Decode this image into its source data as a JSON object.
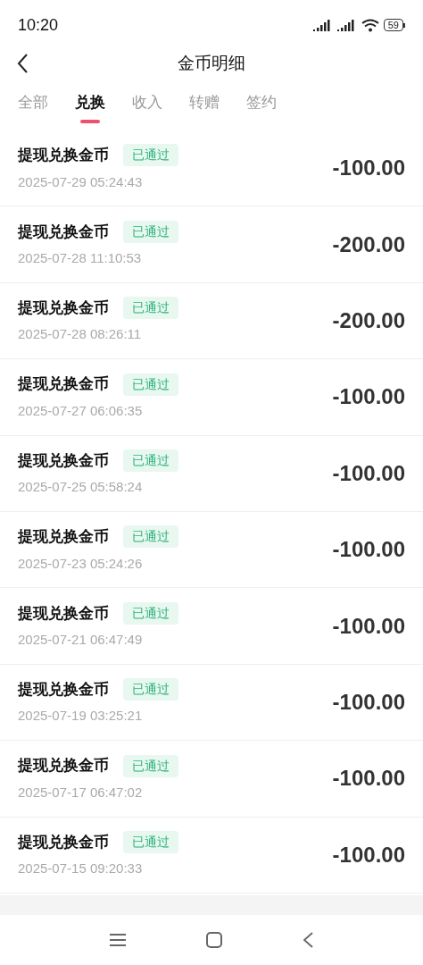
{
  "status_bar": {
    "time": "10:20",
    "battery": "59"
  },
  "header": {
    "title": "金币明细"
  },
  "tabs": [
    {
      "label": "全部",
      "selected": false
    },
    {
      "label": "兑换",
      "selected": true
    },
    {
      "label": "收入",
      "selected": false
    },
    {
      "label": "转赠",
      "selected": false
    },
    {
      "label": "签约",
      "selected": false
    }
  ],
  "records": [
    {
      "title": "提现兑换金币",
      "status": "已通过",
      "time": "2025-07-29 05:24:43",
      "amount": "-100.00"
    },
    {
      "title": "提现兑换金币",
      "status": "已通过",
      "time": "2025-07-28 11:10:53",
      "amount": "-200.00"
    },
    {
      "title": "提现兑换金币",
      "status": "已通过",
      "time": "2025-07-28 08:26:11",
      "amount": "-200.00"
    },
    {
      "title": "提现兑换金币",
      "status": "已通过",
      "time": "2025-07-27 06:06:35",
      "amount": "-100.00"
    },
    {
      "title": "提现兑换金币",
      "status": "已通过",
      "time": "2025-07-25 05:58:24",
      "amount": "-100.00"
    },
    {
      "title": "提现兑换金币",
      "status": "已通过",
      "time": "2025-07-23 05:24:26",
      "amount": "-100.00"
    },
    {
      "title": "提现兑换金币",
      "status": "已通过",
      "time": "2025-07-21 06:47:49",
      "amount": "-100.00"
    },
    {
      "title": "提现兑换金币",
      "status": "已通过",
      "time": "2025-07-19 03:25:21",
      "amount": "-100.00"
    },
    {
      "title": "提现兑换金币",
      "status": "已通过",
      "time": "2025-07-17 06:47:02",
      "amount": "-100.00"
    },
    {
      "title": "提现兑换金币",
      "status": "已通过",
      "time": "2025-07-15 09:20:33",
      "amount": "-100.00"
    }
  ]
}
